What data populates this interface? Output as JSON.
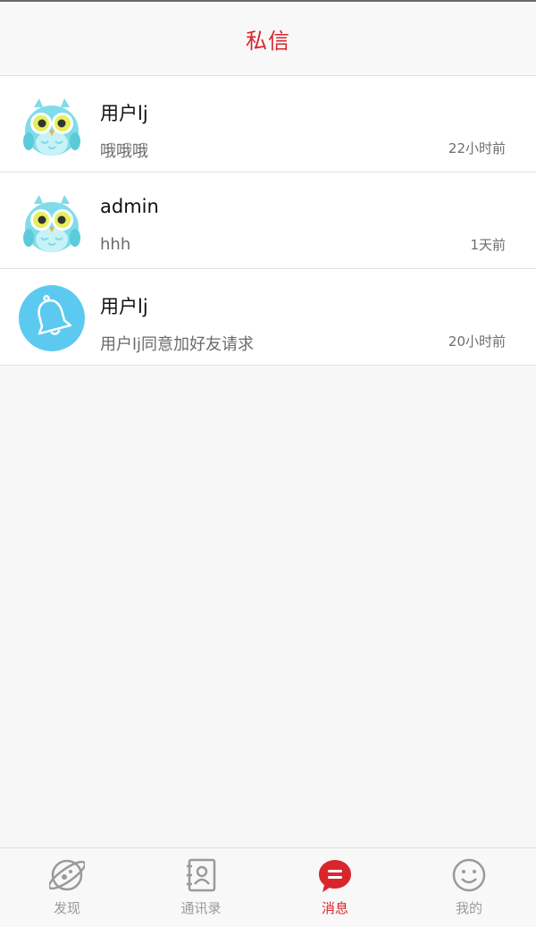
{
  "colors": {
    "accent": "#d9262d",
    "owl": "#7fdce9",
    "bell_bg": "#5ccaf0",
    "inactive": "#9a9a9a"
  },
  "header": {
    "title": "私信"
  },
  "messages": [
    {
      "avatar": "owl-icon",
      "name": "用户lj",
      "preview": "哦哦哦",
      "time": "22小时前"
    },
    {
      "avatar": "owl-icon",
      "name": "admin",
      "preview": "hhh",
      "time": "1天前"
    },
    {
      "avatar": "bell-icon",
      "name": "用户lj",
      "preview": "用户lj同意加好友请求",
      "time": "20小时前"
    }
  ],
  "tabs": [
    {
      "label": "发现",
      "icon": "planet-icon",
      "active": false
    },
    {
      "label": "通讯录",
      "icon": "contacts-icon",
      "active": false
    },
    {
      "label": "消息",
      "icon": "chat-bubble-icon",
      "active": true
    },
    {
      "label": "我的",
      "icon": "smiley-icon",
      "active": false
    }
  ]
}
